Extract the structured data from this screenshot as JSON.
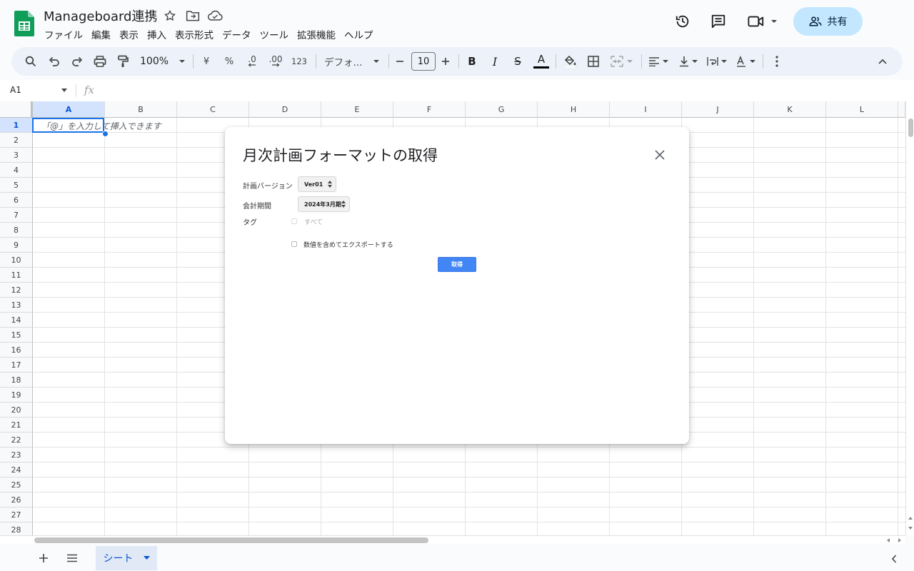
{
  "app": {
    "doc_title": "Manageboard連携"
  },
  "menu": [
    "ファイル",
    "編集",
    "表示",
    "挿入",
    "表示形式",
    "データ",
    "ツール",
    "拡張機能",
    "ヘルプ"
  ],
  "header": {
    "share_label": "共有"
  },
  "toolbar": {
    "zoom": "100%",
    "currency": "¥",
    "percent": "%",
    "decrease_decimal": ".0",
    "increase_decimal": ".00",
    "number_format": "123",
    "font_name": "デフォ...",
    "font_size": "10",
    "bold": "B",
    "italic": "I",
    "strike": "S",
    "text_color": "A"
  },
  "formula_bar": {
    "name_box": "A1",
    "fx": "fx"
  },
  "grid": {
    "columns": [
      "A",
      "B",
      "C",
      "D",
      "E",
      "F",
      "G",
      "H",
      "I",
      "J",
      "K",
      "L"
    ],
    "rows": [
      "1",
      "2",
      "3",
      "4",
      "5",
      "6",
      "7",
      "8",
      "9",
      "10",
      "11",
      "12",
      "13",
      "14",
      "15",
      "16",
      "17",
      "18",
      "19",
      "20",
      "21",
      "22",
      "23",
      "24",
      "25",
      "26",
      "27",
      "28"
    ],
    "cell_hint": "「@」を入力して挿入できます"
  },
  "sheets": {
    "active_tab": "シート"
  },
  "dialog": {
    "title": "月次計画フォーマットの取得",
    "plan_version_label": "計画バージョン",
    "plan_version_value": "Ver01",
    "period_label": "会計期間",
    "period_value": "2024年3月期",
    "tag_label": "タグ",
    "tag_all_label": "すべて",
    "export_values_label": "数値を含めてエクスポートする",
    "fetch_button": "取得"
  },
  "colors": {
    "accent": "#1a73e8",
    "share_bg": "#c2e7ff",
    "toolbar_bg": "#edf2fa",
    "sheets_green": "#0f9d58",
    "fetch_button_bg": "#4285f4"
  }
}
